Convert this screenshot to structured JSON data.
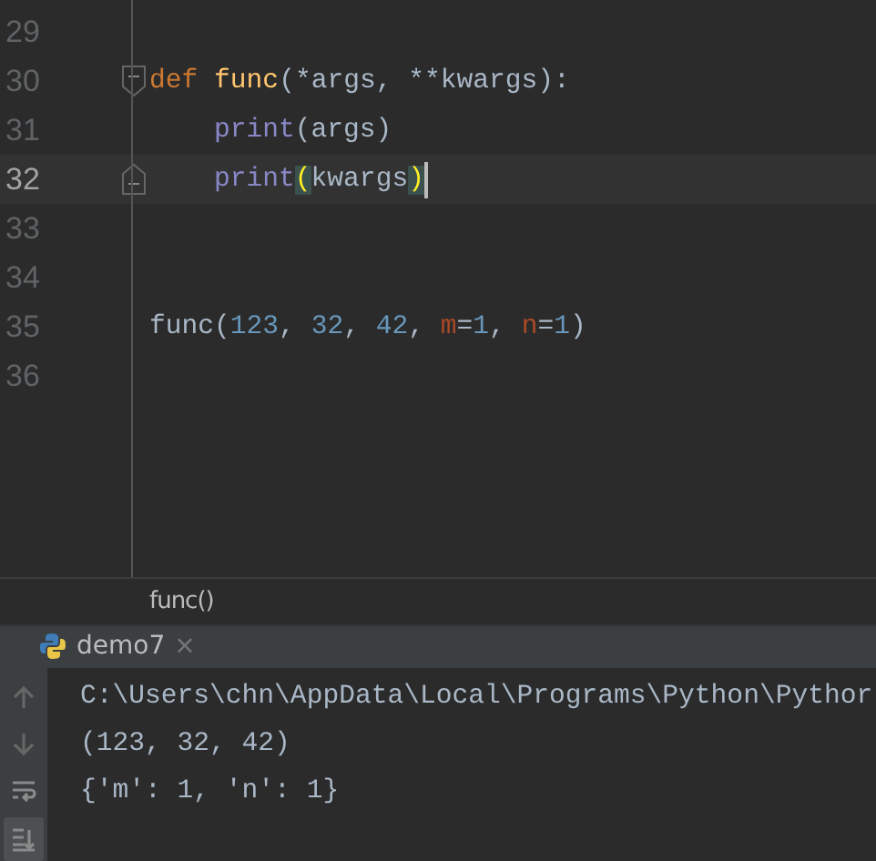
{
  "editor": {
    "lines": [
      {
        "number": "29",
        "current": false,
        "fold_open": false,
        "fold_close": false
      },
      {
        "number": "30",
        "current": false,
        "nested": false,
        "fold_open": true,
        "fold_close": false,
        "tokens": [
          {
            "kind": "keyword",
            "text": "def "
          },
          {
            "kind": "defname",
            "text": "func"
          },
          {
            "kind": "plain",
            "text": "(*args, **kwargs):"
          }
        ]
      },
      {
        "number": "31",
        "current": false,
        "nested": true,
        "fold_open": false,
        "fold_close": false,
        "tokens": [
          {
            "kind": "builtin",
            "text": "print"
          },
          {
            "kind": "plain",
            "text": "(args)"
          }
        ]
      },
      {
        "number": "32",
        "current": true,
        "nested": true,
        "fold_open": false,
        "fold_close": true,
        "caret": true,
        "tokens": [
          {
            "kind": "builtin",
            "text": "print"
          },
          {
            "kind": "plain",
            "text": "(",
            "matched": true
          },
          {
            "kind": "plain",
            "text": "kwargs"
          },
          {
            "kind": "plain",
            "text": ")",
            "matched": true
          }
        ]
      },
      {
        "number": "33",
        "current": false,
        "fold_open": false,
        "fold_close": false
      },
      {
        "number": "34",
        "current": false,
        "fold_open": false,
        "fold_close": false
      },
      {
        "number": "35",
        "current": false,
        "nested": false,
        "fold_open": false,
        "fold_close": false,
        "tokens": [
          {
            "kind": "plain",
            "text": "func("
          },
          {
            "kind": "number",
            "text": "123"
          },
          {
            "kind": "plain",
            "text": ", "
          },
          {
            "kind": "number",
            "text": "32"
          },
          {
            "kind": "plain",
            "text": ", "
          },
          {
            "kind": "number",
            "text": "42"
          },
          {
            "kind": "plain",
            "text": ", "
          },
          {
            "kind": "kwarg",
            "text": "m"
          },
          {
            "kind": "plain",
            "text": "="
          },
          {
            "kind": "number",
            "text": "1"
          },
          {
            "kind": "plain",
            "text": ", "
          },
          {
            "kind": "kwarg",
            "text": "n"
          },
          {
            "kind": "plain",
            "text": "="
          },
          {
            "kind": "number",
            "text": "1"
          },
          {
            "kind": "plain",
            "text": ")"
          }
        ]
      },
      {
        "number": "36",
        "current": false,
        "fold_open": false,
        "fold_close": false
      }
    ]
  },
  "breadcrumb": "func()",
  "run_panel": {
    "tabs": [
      {
        "label": "demo7",
        "close": "×",
        "selected": true
      }
    ],
    "toolbar": [
      {
        "kind": "up",
        "selected": false
      },
      {
        "kind": "down",
        "selected": false
      },
      {
        "kind": "wrap",
        "selected": false
      },
      {
        "kind": "scroll",
        "selected": true
      }
    ],
    "output": [
      "C:\\Users\\chn\\AppData\\Local\\Programs\\Python\\Pythor",
      "(123, 32, 42)",
      "{'m': 1, 'n': 1}"
    ]
  }
}
